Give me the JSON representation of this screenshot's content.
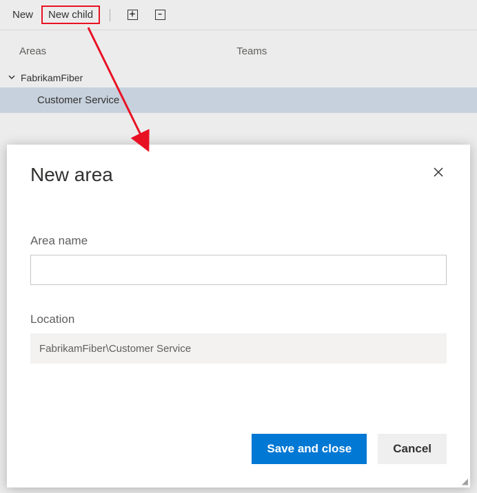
{
  "toolbar": {
    "new_label": "New",
    "new_child_label": "New child"
  },
  "tabs": {
    "areas_label": "Areas",
    "teams_label": "Teams"
  },
  "tree": {
    "root_label": "FabrikamFiber",
    "child_label": "Customer Service"
  },
  "dialog": {
    "title": "New area",
    "area_name_label": "Area name",
    "area_name_value": "",
    "location_label": "Location",
    "location_value": "FabrikamFiber\\Customer Service",
    "save_label": "Save and close",
    "cancel_label": "Cancel"
  }
}
